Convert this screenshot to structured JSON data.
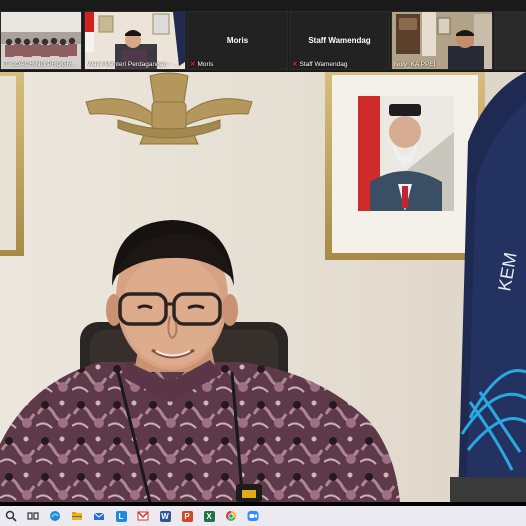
{
  "gallery": {
    "tiles": [
      {
        "caption": "IT COACHING PROGRAM S...",
        "muted": false
      },
      {
        "caption": "Wakil Menteri Perdagangan - Dr...",
        "muted": false
      },
      {
        "caption": "Moris",
        "name": "Moris",
        "muted": true
      },
      {
        "caption": "Staff Wamendag",
        "name": "Staff Wamendag",
        "muted": true
      },
      {
        "caption": "Noly_KA PPEI",
        "muted": false
      },
      {
        "caption": "",
        "muted": false
      }
    ]
  },
  "main_video": {
    "flag_text": "KEM"
  },
  "taskbar": {
    "icons": [
      "windows-search-icon",
      "task-view-icon",
      "edge-icon",
      "file-explorer-icon",
      "mail-icon",
      "lync-icon",
      "gmail-icon",
      "word-icon",
      "powerpoint-icon",
      "excel-icon",
      "chrome-icon",
      "zoom-icon"
    ],
    "colors": {
      "edge": "#1b8ad3",
      "explorer": "#f4b400",
      "mail": "#2a6fd6",
      "lync": "#1e88e5",
      "gmail": "#d93025",
      "word": "#2b579a",
      "powerpoint": "#d24726",
      "excel": "#217346",
      "chrome": "#4caf50",
      "zoom": "#2d8cff"
    }
  }
}
